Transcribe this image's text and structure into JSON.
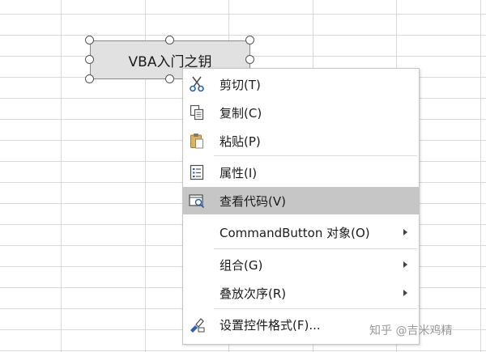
{
  "sheet": {
    "button_caption": "VBA入门之钥"
  },
  "context_menu": {
    "items": [
      {
        "label": "剪切(T)",
        "icon": "scissors-icon"
      },
      {
        "label": "复制(C)",
        "icon": "copy-icon"
      },
      {
        "label": "粘贴(P)",
        "icon": "paste-icon"
      },
      {
        "label": "属性(I)",
        "icon": "properties-icon"
      },
      {
        "label": "查看代码(V)",
        "icon": "view-code-icon",
        "highlighted": true
      },
      {
        "label": "CommandButton 对象(O)",
        "submenu": true
      },
      {
        "label": "组合(G)",
        "submenu": true
      },
      {
        "label": "叠放次序(R)",
        "submenu": true
      },
      {
        "label": "设置控件格式(F)...",
        "icon": "format-control-icon"
      }
    ]
  },
  "watermark": "知乎 @吉米鸡精",
  "colors": {
    "menu_highlight": "#c6c6c6",
    "button_face": "#e1e1e1",
    "grid_line": "#d9d9d9"
  }
}
